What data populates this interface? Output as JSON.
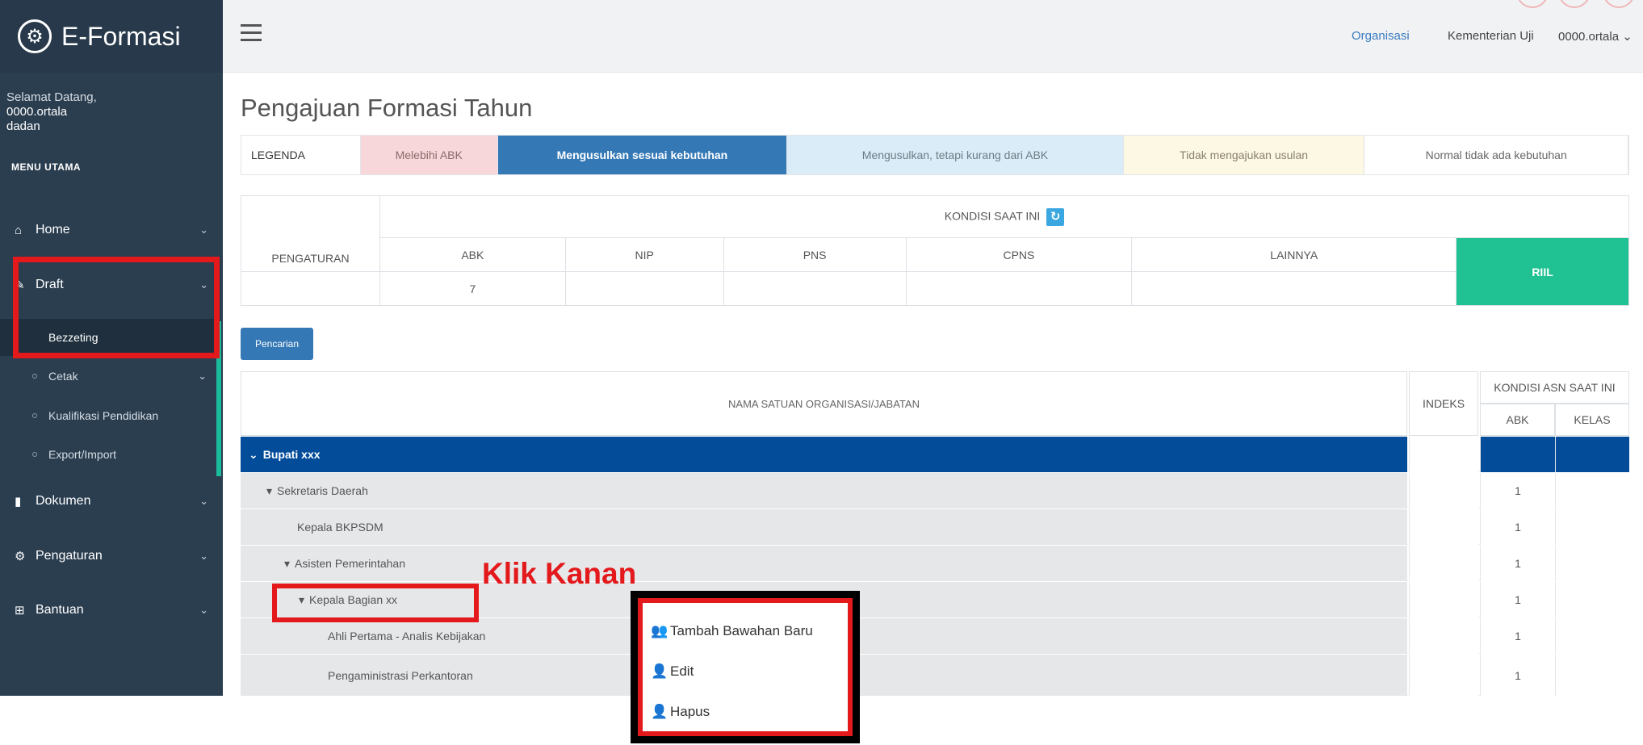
{
  "app": {
    "title": "E-Formasi",
    "logo_icon": "gear-icon"
  },
  "sidebar": {
    "welcome_line1": "Selamat Datang,",
    "welcome_user": "0000.ortala",
    "welcome_name": "dadan",
    "menu_heading": "MENU UTAMA",
    "items": [
      {
        "label": "Home",
        "icon": "home-icon"
      },
      {
        "label": "Draft",
        "icon": "edit-icon"
      },
      {
        "label": "Dokumen",
        "icon": "document-icon"
      },
      {
        "label": "Pengaturan",
        "icon": "gears-icon"
      },
      {
        "label": "Bantuan",
        "icon": "table-icon"
      }
    ],
    "draft_subitems": [
      {
        "label": "Bezzeting"
      },
      {
        "label": "Cetak"
      },
      {
        "label": "Kualifikasi Pendidikan"
      },
      {
        "label": "Export/Import"
      }
    ]
  },
  "topbar": {
    "organisasi": "Organisasi",
    "kementerian": "Kementerian Uji",
    "user": "0000.ortala"
  },
  "page": {
    "title": "Pengajuan Formasi Tahun"
  },
  "legend": {
    "label": "LEGENDA",
    "melebihi": "Melebihi ABK",
    "sesuai": "Mengusulkan sesuai kebutuhan",
    "kurang": "Mengusulkan, tetapi kurang dari ABK",
    "tidak": "Tidak mengajukan usulan",
    "normal": "Normal tidak ada kebutuhan",
    "colors": {
      "melebihi": "#f7d7d9",
      "sesuai": "#3478b5",
      "kurang": "#d9ecf7",
      "tidak": "#fcf8e3",
      "normal": "#ffffff"
    }
  },
  "kondisi": {
    "title": "KONDISI SAAT INI",
    "pengaturan": "PENGATURAN",
    "cols": [
      "ABK",
      "NIP",
      "PNS",
      "CPNS",
      "LAINNYA"
    ],
    "riil": "RIIL",
    "abk_value": "7"
  },
  "search_button": "Pencarian",
  "table": {
    "org_header": "NAMA SATUAN ORGANISASI/JABATAN",
    "indeks_header": "INDEKS",
    "asn_header": "KONDISI ASN SAAT INI",
    "abk_header": "ABK",
    "kelas_header": "KELAS",
    "rows": [
      {
        "name": "Bupati xxx",
        "abk": ""
      },
      {
        "name": "Sekretaris Daerah",
        "abk": "1"
      },
      {
        "name": "Kepala BKPSDM",
        "abk": "1"
      },
      {
        "name": "Asisten Pemerintahan",
        "abk": "1"
      },
      {
        "name": "Kepala Bagian xx",
        "abk": "1"
      },
      {
        "name": "Ahli Pertama - Analis Kebijakan",
        "abk": "1"
      },
      {
        "name": "Pengaministrasi Perkantoran",
        "abk": "1"
      }
    ]
  },
  "annotation": {
    "klik_kanan": "Klik Kanan"
  },
  "context_menu": [
    {
      "label": "Tambah Bawahan Baru",
      "icon": "users-icon"
    },
    {
      "label": "Edit",
      "icon": "user-edit-icon"
    },
    {
      "label": "Hapus",
      "icon": "user-delete-icon"
    }
  ]
}
